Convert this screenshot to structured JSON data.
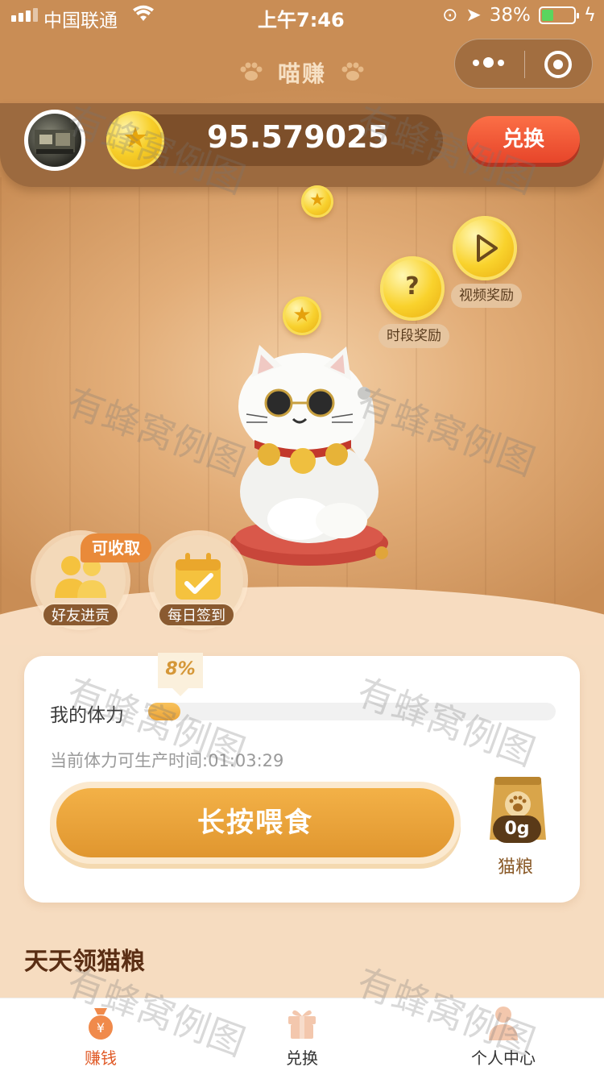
{
  "status_bar": {
    "carrier": "中国联通",
    "time": "上午7:46",
    "battery_percent_text": "38%",
    "battery_level": 0.38
  },
  "header": {
    "title": "喵赚",
    "capsule": {
      "more_icon": "more-dots-icon",
      "close_icon": "target-circle-icon"
    }
  },
  "wallet": {
    "balance": "95.579025",
    "exchange_label": "兑换"
  },
  "rewards": {
    "time_reward_glyph": "?",
    "time_reward_label": "时段奖励",
    "video_reward_label": "视频奖励"
  },
  "actions": {
    "friend_label": "好友进贡",
    "collect_badge": "可收取",
    "daily_label": "每日签到"
  },
  "stamina": {
    "percent_text": "8%",
    "percent": 8,
    "label": "我的体力",
    "timer_text": "当前体力可生产时间:01:03:29"
  },
  "feed": {
    "button_label": "长按喂食",
    "food_qty": "0g",
    "food_label": "猫粮"
  },
  "section": {
    "title": "天天领猫粮"
  },
  "tabs": [
    {
      "label": "赚钱",
      "icon": "money-bag-icon",
      "active": true
    },
    {
      "label": "兑换",
      "icon": "gift-icon",
      "active": false
    },
    {
      "label": "个人中心",
      "icon": "person-icon",
      "active": false
    }
  ],
  "watermark": "有蜂窝例图",
  "colors": {
    "accent": "#e05a27",
    "panel": "#9c6a3f",
    "gold": "#f7cf2a",
    "button_orange": "#eca437"
  }
}
